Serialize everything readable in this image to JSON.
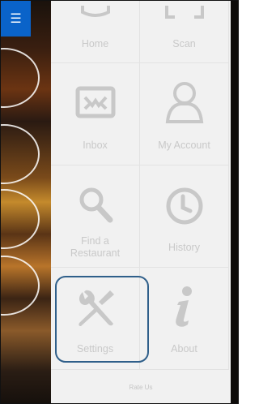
{
  "menu": {
    "icon": "hamburger-menu-icon",
    "accent": "#0a63c9"
  },
  "drawer": {
    "items": [
      {
        "label": "Home",
        "icon": "home-icon"
      },
      {
        "label": "Scan",
        "icon": "scan-icon"
      },
      {
        "label": "Inbox",
        "icon": "inbox-icon"
      },
      {
        "label": "My Account",
        "icon": "user-icon"
      },
      {
        "label": "Find a Restaurant",
        "label_line1": "Find a",
        "label_line2": "Restaurant",
        "icon": "search-icon"
      },
      {
        "label": "History",
        "icon": "clock-icon"
      },
      {
        "label": "Settings",
        "icon": "wrench-screwdriver-icon"
      },
      {
        "label": "About",
        "icon": "info-icon"
      }
    ],
    "footer_link": "Rate Us",
    "highlight_color": "#2f5f8a"
  }
}
